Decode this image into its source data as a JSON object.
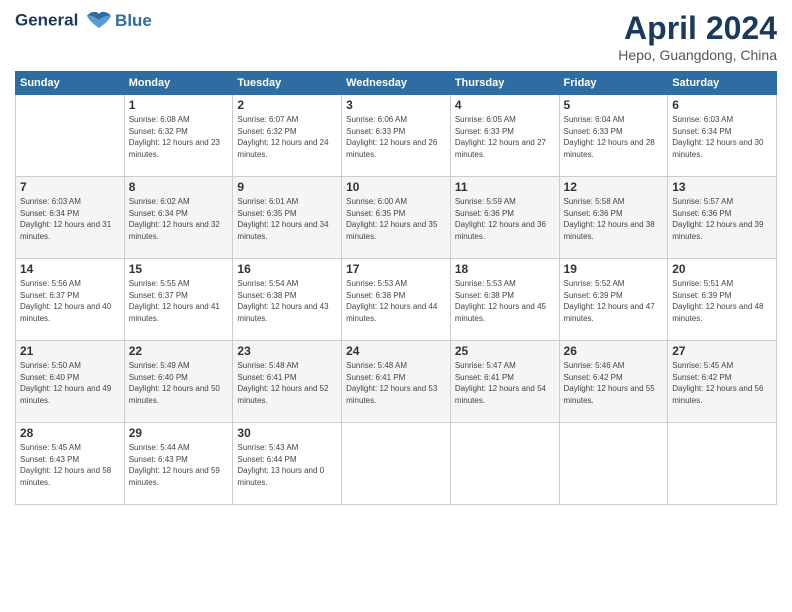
{
  "header": {
    "logo_line1": "General",
    "logo_line2": "Blue",
    "month_year": "April 2024",
    "location": "Hepo, Guangdong, China"
  },
  "days_of_week": [
    "Sunday",
    "Monday",
    "Tuesday",
    "Wednesday",
    "Thursday",
    "Friday",
    "Saturday"
  ],
  "weeks": [
    [
      {
        "day": "",
        "sunrise": "",
        "sunset": "",
        "daylight": ""
      },
      {
        "day": "1",
        "sunrise": "Sunrise: 6:08 AM",
        "sunset": "Sunset: 6:32 PM",
        "daylight": "Daylight: 12 hours and 23 minutes."
      },
      {
        "day": "2",
        "sunrise": "Sunrise: 6:07 AM",
        "sunset": "Sunset: 6:32 PM",
        "daylight": "Daylight: 12 hours and 24 minutes."
      },
      {
        "day": "3",
        "sunrise": "Sunrise: 6:06 AM",
        "sunset": "Sunset: 6:33 PM",
        "daylight": "Daylight: 12 hours and 26 minutes."
      },
      {
        "day": "4",
        "sunrise": "Sunrise: 6:05 AM",
        "sunset": "Sunset: 6:33 PM",
        "daylight": "Daylight: 12 hours and 27 minutes."
      },
      {
        "day": "5",
        "sunrise": "Sunrise: 6:04 AM",
        "sunset": "Sunset: 6:33 PM",
        "daylight": "Daylight: 12 hours and 28 minutes."
      },
      {
        "day": "6",
        "sunrise": "Sunrise: 6:03 AM",
        "sunset": "Sunset: 6:34 PM",
        "daylight": "Daylight: 12 hours and 30 minutes."
      }
    ],
    [
      {
        "day": "7",
        "sunrise": "Sunrise: 6:03 AM",
        "sunset": "Sunset: 6:34 PM",
        "daylight": "Daylight: 12 hours and 31 minutes."
      },
      {
        "day": "8",
        "sunrise": "Sunrise: 6:02 AM",
        "sunset": "Sunset: 6:34 PM",
        "daylight": "Daylight: 12 hours and 32 minutes."
      },
      {
        "day": "9",
        "sunrise": "Sunrise: 6:01 AM",
        "sunset": "Sunset: 6:35 PM",
        "daylight": "Daylight: 12 hours and 34 minutes."
      },
      {
        "day": "10",
        "sunrise": "Sunrise: 6:00 AM",
        "sunset": "Sunset: 6:35 PM",
        "daylight": "Daylight: 12 hours and 35 minutes."
      },
      {
        "day": "11",
        "sunrise": "Sunrise: 5:59 AM",
        "sunset": "Sunset: 6:36 PM",
        "daylight": "Daylight: 12 hours and 36 minutes."
      },
      {
        "day": "12",
        "sunrise": "Sunrise: 5:58 AM",
        "sunset": "Sunset: 6:36 PM",
        "daylight": "Daylight: 12 hours and 38 minutes."
      },
      {
        "day": "13",
        "sunrise": "Sunrise: 5:57 AM",
        "sunset": "Sunset: 6:36 PM",
        "daylight": "Daylight: 12 hours and 39 minutes."
      }
    ],
    [
      {
        "day": "14",
        "sunrise": "Sunrise: 5:56 AM",
        "sunset": "Sunset: 6:37 PM",
        "daylight": "Daylight: 12 hours and 40 minutes."
      },
      {
        "day": "15",
        "sunrise": "Sunrise: 5:55 AM",
        "sunset": "Sunset: 6:37 PM",
        "daylight": "Daylight: 12 hours and 41 minutes."
      },
      {
        "day": "16",
        "sunrise": "Sunrise: 5:54 AM",
        "sunset": "Sunset: 6:38 PM",
        "daylight": "Daylight: 12 hours and 43 minutes."
      },
      {
        "day": "17",
        "sunrise": "Sunrise: 5:53 AM",
        "sunset": "Sunset: 6:38 PM",
        "daylight": "Daylight: 12 hours and 44 minutes."
      },
      {
        "day": "18",
        "sunrise": "Sunrise: 5:53 AM",
        "sunset": "Sunset: 6:38 PM",
        "daylight": "Daylight: 12 hours and 45 minutes."
      },
      {
        "day": "19",
        "sunrise": "Sunrise: 5:52 AM",
        "sunset": "Sunset: 6:39 PM",
        "daylight": "Daylight: 12 hours and 47 minutes."
      },
      {
        "day": "20",
        "sunrise": "Sunrise: 5:51 AM",
        "sunset": "Sunset: 6:39 PM",
        "daylight": "Daylight: 12 hours and 48 minutes."
      }
    ],
    [
      {
        "day": "21",
        "sunrise": "Sunrise: 5:50 AM",
        "sunset": "Sunset: 6:40 PM",
        "daylight": "Daylight: 12 hours and 49 minutes."
      },
      {
        "day": "22",
        "sunrise": "Sunrise: 5:49 AM",
        "sunset": "Sunset: 6:40 PM",
        "daylight": "Daylight: 12 hours and 50 minutes."
      },
      {
        "day": "23",
        "sunrise": "Sunrise: 5:48 AM",
        "sunset": "Sunset: 6:41 PM",
        "daylight": "Daylight: 12 hours and 52 minutes."
      },
      {
        "day": "24",
        "sunrise": "Sunrise: 5:48 AM",
        "sunset": "Sunset: 6:41 PM",
        "daylight": "Daylight: 12 hours and 53 minutes."
      },
      {
        "day": "25",
        "sunrise": "Sunrise: 5:47 AM",
        "sunset": "Sunset: 6:41 PM",
        "daylight": "Daylight: 12 hours and 54 minutes."
      },
      {
        "day": "26",
        "sunrise": "Sunrise: 5:46 AM",
        "sunset": "Sunset: 6:42 PM",
        "daylight": "Daylight: 12 hours and 55 minutes."
      },
      {
        "day": "27",
        "sunrise": "Sunrise: 5:45 AM",
        "sunset": "Sunset: 6:42 PM",
        "daylight": "Daylight: 12 hours and 56 minutes."
      }
    ],
    [
      {
        "day": "28",
        "sunrise": "Sunrise: 5:45 AM",
        "sunset": "Sunset: 6:43 PM",
        "daylight": "Daylight: 12 hours and 58 minutes."
      },
      {
        "day": "29",
        "sunrise": "Sunrise: 5:44 AM",
        "sunset": "Sunset: 6:43 PM",
        "daylight": "Daylight: 12 hours and 59 minutes."
      },
      {
        "day": "30",
        "sunrise": "Sunrise: 5:43 AM",
        "sunset": "Sunset: 6:44 PM",
        "daylight": "Daylight: 13 hours and 0 minutes."
      },
      {
        "day": "",
        "sunrise": "",
        "sunset": "",
        "daylight": ""
      },
      {
        "day": "",
        "sunrise": "",
        "sunset": "",
        "daylight": ""
      },
      {
        "day": "",
        "sunrise": "",
        "sunset": "",
        "daylight": ""
      },
      {
        "day": "",
        "sunrise": "",
        "sunset": "",
        "daylight": ""
      }
    ]
  ]
}
